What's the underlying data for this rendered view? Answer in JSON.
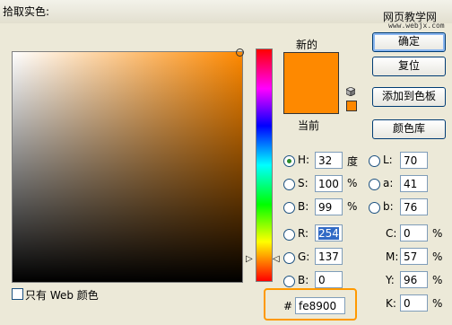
{
  "window": {
    "title": "拾取实色:"
  },
  "watermark": {
    "line1": "网页教学网",
    "line2": "www.webjx.com"
  },
  "picker": {
    "selected_color": "#fe8900"
  },
  "preview": {
    "new_label": "新的",
    "current_label": "当前",
    "new_color": "#fe8900",
    "current_color": "#fe8900",
    "websafe_color": "#ff8800"
  },
  "buttons": {
    "ok": "确定",
    "reset": "复位",
    "add_swatch": "添加到色板",
    "libraries": "颜色库"
  },
  "hsb": {
    "h": {
      "label": "H:",
      "value": "32",
      "unit": "度"
    },
    "s": {
      "label": "S:",
      "value": "100",
      "unit": "%"
    },
    "b": {
      "label": "B:",
      "value": "99",
      "unit": "%"
    }
  },
  "rgb": {
    "r": {
      "label": "R:",
      "value": "254"
    },
    "g": {
      "label": "G:",
      "value": "137"
    },
    "b": {
      "label": "B:",
      "value": "0"
    }
  },
  "lab": {
    "l": {
      "label": "L:",
      "value": "70"
    },
    "a": {
      "label": "a:",
      "value": "41"
    },
    "b": {
      "label": "b:",
      "value": "76"
    }
  },
  "cmyk": {
    "c": {
      "label": "C:",
      "value": "0",
      "unit": "%"
    },
    "m": {
      "label": "M:",
      "value": "57",
      "unit": "%"
    },
    "y": {
      "label": "Y:",
      "value": "96",
      "unit": "%"
    },
    "k": {
      "label": "K:",
      "value": "0",
      "unit": "%"
    }
  },
  "hex": {
    "label": "#",
    "value": "fe8900"
  },
  "web_only": {
    "label": "只有 Web 颜色"
  }
}
